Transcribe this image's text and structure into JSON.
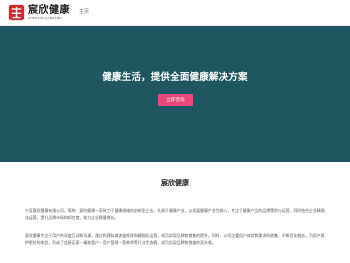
{
  "header": {
    "logo_cn": "宸欣健康",
    "logo_en": "CHENXIN JIANKANG",
    "nav_home": "主页"
  },
  "hero": {
    "title": "健康生活，提供全面健康解决方案",
    "button_label": "立即咨询",
    "background_color": "#1e5761",
    "button_color": "#e8497a"
  },
  "about": {
    "title": "宸欣健康",
    "paragraph1": "宁夏宸欣健康有限公司，简称：宸欣健康一家致力于健康领域的创新型企业。扎根于健康产业，以发展健康产业为核心，专注于健康产品的品牌策划与运营，同时结合企业精细化运营，提升品牌市场和知名度，助力企业稳健增长。",
    "paragraph2": "宸欣健康专注于用户的深度互动和沟通，通过构建私域流量矩阵和精细化运营，成功实现品牌和销售的提升。同时，公司注重用户体验和需求的收集，不断优化服务，为用户提供更好的体验，形成了连接买家－精准客户－用户管理－营养师等行业生态圈，成功实现品牌和销量的双丰收。"
  }
}
